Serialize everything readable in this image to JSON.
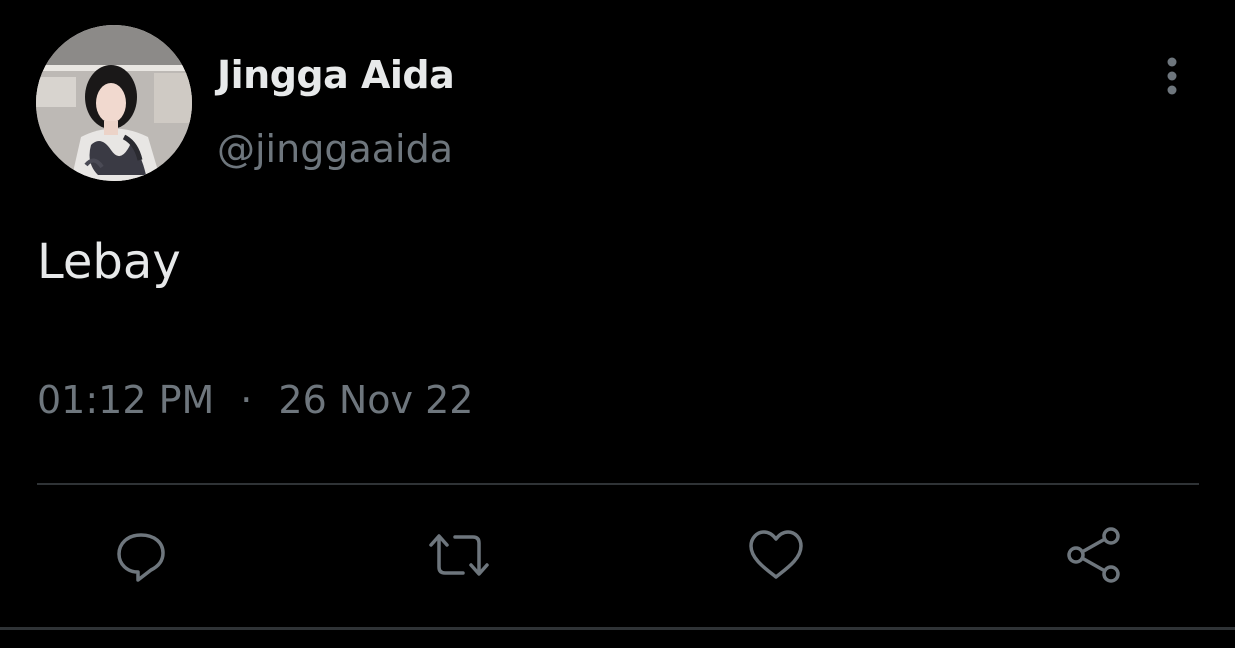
{
  "tweet": {
    "author": {
      "display_name": "Jingga Aida",
      "handle": "@jinggaaida"
    },
    "text": "Lebay",
    "time": "01:12 PM",
    "separator": "·",
    "date": "26 Nov 22"
  },
  "actions": [
    {
      "icon": "reply-icon"
    },
    {
      "icon": "retweet-icon"
    },
    {
      "icon": "like-icon"
    },
    {
      "icon": "share-icon"
    }
  ],
  "menu": {
    "icon": "more-vertical-icon"
  },
  "colors": {
    "background": "#000000",
    "primary_text": "#e7e9ea",
    "secondary_text": "#6e767d",
    "divider": "#2f3336"
  }
}
